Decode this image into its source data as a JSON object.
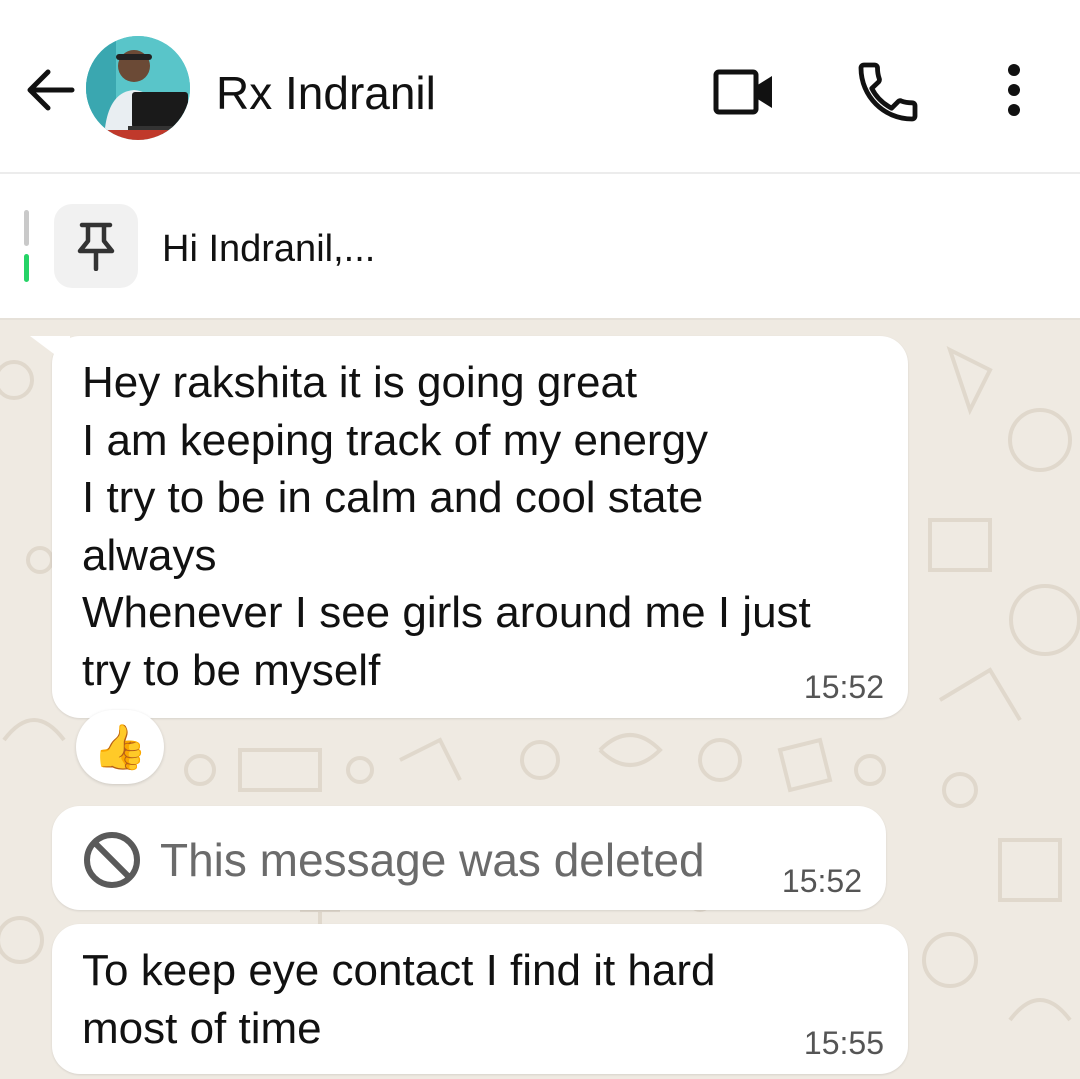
{
  "header": {
    "contact_name": "Rx Indranil"
  },
  "pinned": {
    "text": "Hi Indranil,..."
  },
  "messages": [
    {
      "text": "Hey rakshita it is going great\nI am keeping track of my energy\nI try to be in calm and cool state\nalways\nWhenever I see girls around me I just\ntry to be myself",
      "time": "15:52",
      "reaction": "👍"
    },
    {
      "text": "This message was deleted",
      "time": "15:52",
      "deleted": true
    },
    {
      "text": "To keep eye contact I find it hard\nmost of time",
      "time": "15:55"
    }
  ],
  "colors": {
    "chat_background": "#efeae2",
    "bubble": "#ffffff",
    "pin_indicator_active": "#25d366"
  },
  "icons": [
    "back-arrow-icon",
    "video-call-icon",
    "voice-call-icon",
    "more-options-icon",
    "pin-icon",
    "deleted-icon",
    "thumbs-up-reaction"
  ]
}
